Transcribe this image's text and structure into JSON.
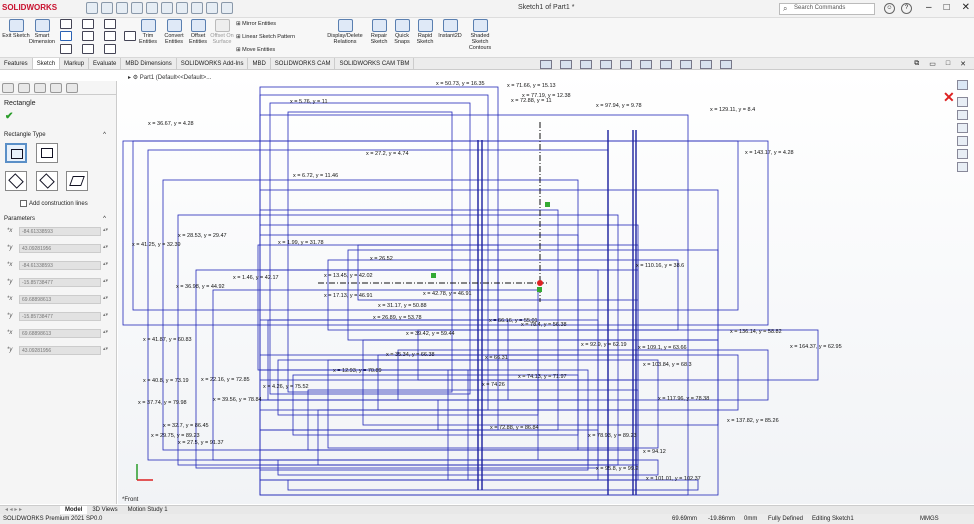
{
  "window": {
    "brand": "SOLIDWORKS",
    "title": "Sketch1 of Part1 *",
    "search_placeholder": "Search Commands",
    "win_controls": [
      "–",
      "□",
      "✕"
    ]
  },
  "commands": {
    "exit_sketch": "Exit Sketch",
    "smart_dimension": "Smart Dimension",
    "trim": "Trim Entities",
    "convert": "Convert Entities",
    "offset": "Offset Entities",
    "offset_surface": "Offset On Surface",
    "mirror": "Mirror Entities",
    "linear_pattern": "Linear Sketch Pattern",
    "move": "Move Entities",
    "display_delete": "Display/Delete Relations",
    "repair": "Repair Sketch",
    "quick_snaps": "Quick Snaps",
    "rapid_sketch": "Rapid Sketch",
    "instant2d": "Instant2D",
    "shaded": "Shaded Sketch Contours"
  },
  "tabs": [
    "Features",
    "Sketch",
    "Markup",
    "Evaluate",
    "MBD Dimensions",
    "SOLIDWORKS Add-Ins",
    "MBD",
    "SOLIDWORKS CAM",
    "SOLIDWORKS CAM TBM"
  ],
  "active_tab": "Sketch",
  "panel": {
    "title": "Rectangle",
    "rect_type": "Rectangle Type",
    "construction": "Add construction lines",
    "parameters": "Parameters",
    "params": [
      "-84.61338593",
      "43.09281956",
      "-84.61338593",
      "-15.85738477",
      "69.68898613",
      "-15.85738477",
      "69.68898613",
      "43.09281956"
    ]
  },
  "tree": "Part1  (Default<<Default>...",
  "view_label": "*Front",
  "bottom_tabs": [
    "Model",
    "3D Views",
    "Motion Study 1"
  ],
  "active_bottom": "Model",
  "status": {
    "version": "SOLIDWORKS Premium 2021 SP0.0",
    "x": "69.69mm",
    "y": "-19.86mm",
    "z": "0mm",
    "state": "Fully Defined",
    "editing": "Editing Sketch1",
    "units": "MMGS"
  },
  "coords": [
    "x = 50.73, y = 16.35",
    "x = 71.66, y = 15.13",
    "x = 77.19, y = 12.38",
    "x = 72.88, y = 11",
    "x = 97.94, y = 9.78",
    "x = 129.11, y = 8.4",
    "x = 36.67, y = 4.28",
    "x = 5.76, y = 11",
    "x = 143.17, y = 4.28",
    "x = 27.2, y = 4.74",
    "x = 6.72, y = 11.46",
    "x = 41.25, y = 32.39",
    "x = 28.53, y = 29.47",
    "x = 1.99, y = 31.78",
    "x = 26.52",
    "x = 110.16, y = 38.6",
    "x = 1.46, y = 42.17",
    "x = 13.45, y = 42.02",
    "x = 36.98, y = 44.92",
    "x = 17.13, y = 46.91",
    "x = 42.78, y = 46.91",
    "x = 31.17, y = 50.88",
    "x = 26.89, y = 53.78",
    "x = 66.16, y = 55.01",
    "x = 78.4, y = 56.38",
    "x = 136.14, y = 58.82",
    "x = 41.87, y = 60.83",
    "x = 39.42, y = 59.44",
    "x = 92.9, y = 62.19",
    "x = 109.1, y = 63.66",
    "x = 164.37, y = 62.95",
    "x = 35.34, y = 66.38",
    "x = 66.31",
    "x = 103.84, y = 68.3",
    "x = 12.93, y = 70.89",
    "x = 74.13, y = 71.97",
    "x = 40.8, y = 73.19",
    "x = 22.16, y = 72.85",
    "x = 74.26",
    "x = 4.26, y = 75.52",
    "x = 117.96, y = 78.38",
    "x = 37.74, y = 79.98",
    "x = 39.56, y = 78.84",
    "x = 137.82, y = 85.26",
    "x = 32.7, y = 86.45",
    "x = 72.88, y = 86.84",
    "x = 29.75, y = 89.23",
    "x = 78.93, y = 89.23",
    "x = 27.5, y = 91.37",
    "x = 95.8, y = 99.2",
    "x = 94.12",
    "x = 101.01, y = 102.37"
  ]
}
